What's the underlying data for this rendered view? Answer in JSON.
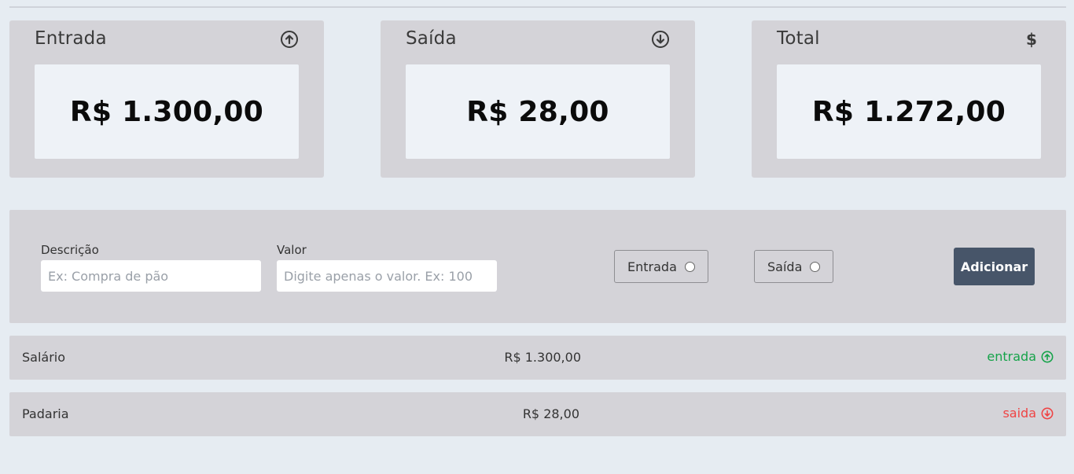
{
  "summary": {
    "income": {
      "title": "Entrada",
      "value": "R$ 1.300,00",
      "icon": "arrow-up-circle-icon"
    },
    "expense": {
      "title": "Saída",
      "value": "R$ 28,00",
      "icon": "arrow-down-circle-icon"
    },
    "total": {
      "title": "Total",
      "value": "R$ 1.272,00",
      "icon_text": "$"
    }
  },
  "form": {
    "description_label": "Descrição",
    "description_placeholder": "Ex: Compra de pão",
    "value_label": "Valor",
    "value_placeholder": "Digite apenas o valor. Ex: 100",
    "radio_income_label": "Entrada",
    "radio_expense_label": "Saída",
    "add_button_label": "Adicionar"
  },
  "transactions": [
    {
      "description": "Salário",
      "value": "R$ 1.300,00",
      "type": "entrada",
      "type_color": "#16a34a"
    },
    {
      "description": "Padaria",
      "value": "R$ 28,00",
      "type": "saida",
      "type_color": "#ef4444"
    }
  ],
  "colors": {
    "background": "#e6ecf2",
    "panel": "#d4d3d8",
    "button": "#475569",
    "income": "#16a34a",
    "expense": "#ef4444"
  }
}
